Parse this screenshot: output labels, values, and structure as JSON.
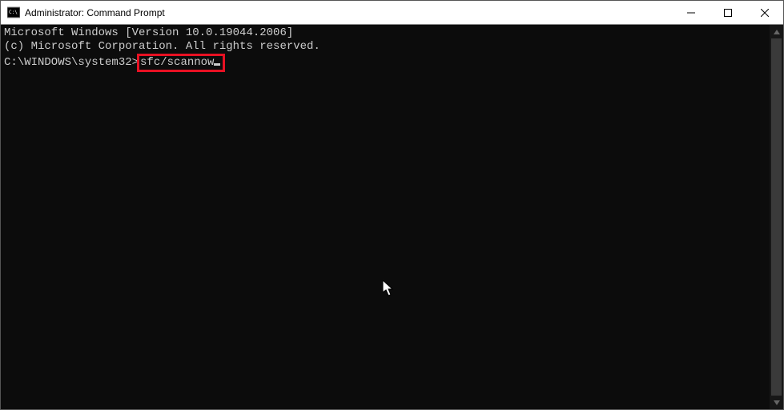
{
  "window": {
    "title": "Administrator: Command Prompt"
  },
  "console": {
    "line1": "Microsoft Windows [Version 10.0.19044.2006]",
    "line2": "(c) Microsoft Corporation. All rights reserved.",
    "blank": "",
    "prompt": "C:\\WINDOWS\\system32>",
    "command": "sfc/scannow"
  }
}
